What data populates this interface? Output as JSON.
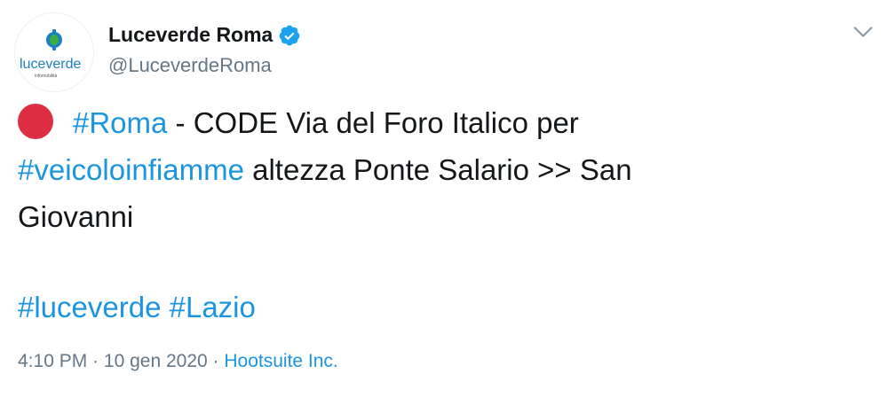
{
  "user": {
    "display_name": "Luceverde Roma",
    "handle": "@LuceverdeRoma",
    "verified": true,
    "avatar_logo_text": "luceverde",
    "avatar_logo_subtext": "infomobilità"
  },
  "tweet": {
    "emoji": "red-circle",
    "hashtag_1": "#Roma",
    "text_1": " - CODE  Via del Foro Italico per",
    "hashtag_2": "#veicoloinfiamme",
    "text_2": " altezza Ponte Salario >>  San",
    "text_3": "Giovanni",
    "hashtag_3": "#luceverde",
    "hashtag_4": "#Lazio"
  },
  "meta": {
    "time": "4:10 PM",
    "separator_1": " · ",
    "date": "10 gen 2020",
    "separator_2": " · ",
    "source": "Hootsuite Inc."
  },
  "colors": {
    "link": "#1b95e0",
    "text": "#14171a",
    "muted": "#657786",
    "emoji_red": "#dd2e44",
    "verified_blue": "#1da1f2"
  }
}
